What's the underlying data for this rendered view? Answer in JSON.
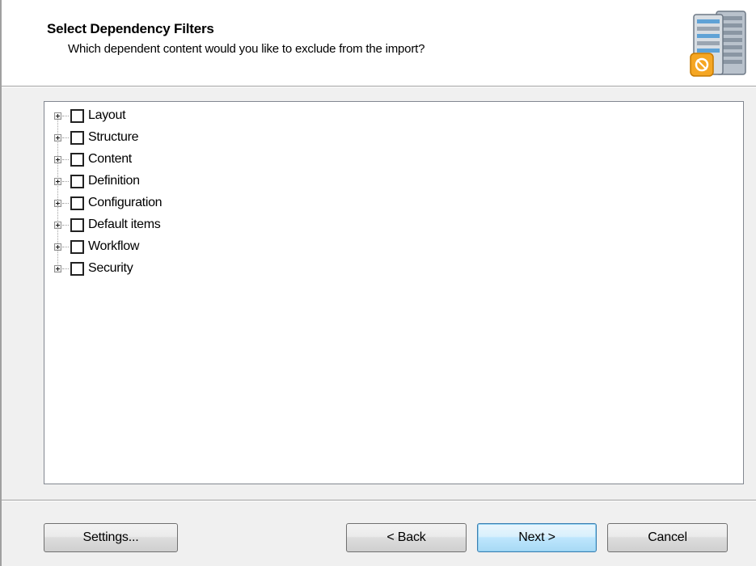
{
  "header": {
    "title": "Select Dependency Filters",
    "subtitle": "Which dependent content would you like to exclude from the import?",
    "logo_icon": "server-import-icon"
  },
  "tree": {
    "items": [
      {
        "label": "Layout",
        "checked": false
      },
      {
        "label": "Structure",
        "checked": false
      },
      {
        "label": "Content",
        "checked": false
      },
      {
        "label": "Definition",
        "checked": false
      },
      {
        "label": "Configuration",
        "checked": false
      },
      {
        "label": "Default items",
        "checked": false
      },
      {
        "label": "Workflow",
        "checked": false
      },
      {
        "label": "Security",
        "checked": false
      }
    ]
  },
  "buttons": {
    "settings": "Settings...",
    "back": "< Back",
    "next": "Next >",
    "cancel": "Cancel"
  },
  "colors": {
    "window_bg": "#f0f0f0",
    "header_bg": "#ffffff",
    "default_button_border": "#3c7fb1",
    "logo_accent": "#f5a623"
  }
}
